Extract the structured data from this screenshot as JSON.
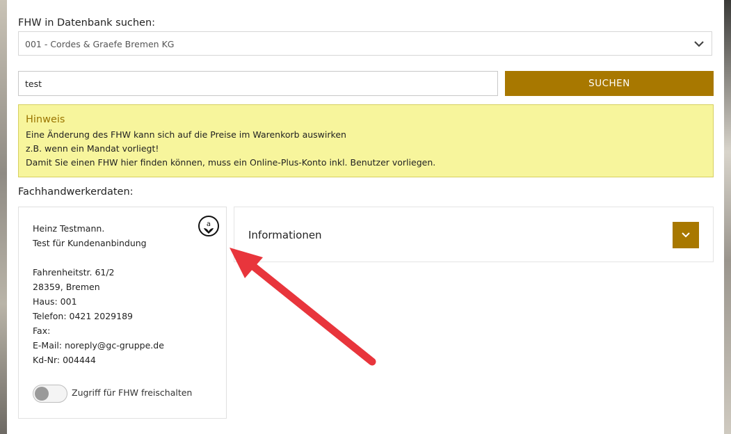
{
  "search": {
    "label": "FHW in Datenbank suchen:",
    "selected_value": "001 - Cordes & Graefe Bremen KG",
    "input_value": "test",
    "button_label": "SUCHEN"
  },
  "hint": {
    "title": "Hinweis",
    "lines": [
      "Eine Änderung des FHW kann sich auf die Preise im Warenkorb auswirken",
      "z.B. wenn ein Mandat vorliegt!",
      "Damit Sie einen FHW hier finden können, muss ein Online-Plus-Konto inkl. Benutzer vorliegen."
    ]
  },
  "data_section": {
    "label": "Fachhandwerkerdaten:",
    "card": {
      "name": "Heinz Testmann.",
      "company": "Test für Kundenanbindung",
      "street": "Fahrenheitstr. 61/2",
      "city": "28359, Bremen",
      "house": "Haus: 001",
      "phone": "Telefon: 0421 2029189",
      "fax": "Fax:",
      "email": "E-Mail: noreply@gc-gruppe.de",
      "customer_no": "Kd-Nr: 004444",
      "toggle_label": "Zugriff für FHW freischalten",
      "toggle_on": false
    },
    "info_panel": {
      "title": "Informationen"
    }
  },
  "icons": {
    "select_chevron": "chevron-down-icon",
    "expand": "chevron-down-icon",
    "badge": "partner-badge-icon",
    "arrow": "red-arrow-annotation"
  },
  "colors": {
    "accent": "#a87800",
    "hint_background": "#f7f59c",
    "hint_title": "#9a7400",
    "arrow": "#e8353c"
  }
}
